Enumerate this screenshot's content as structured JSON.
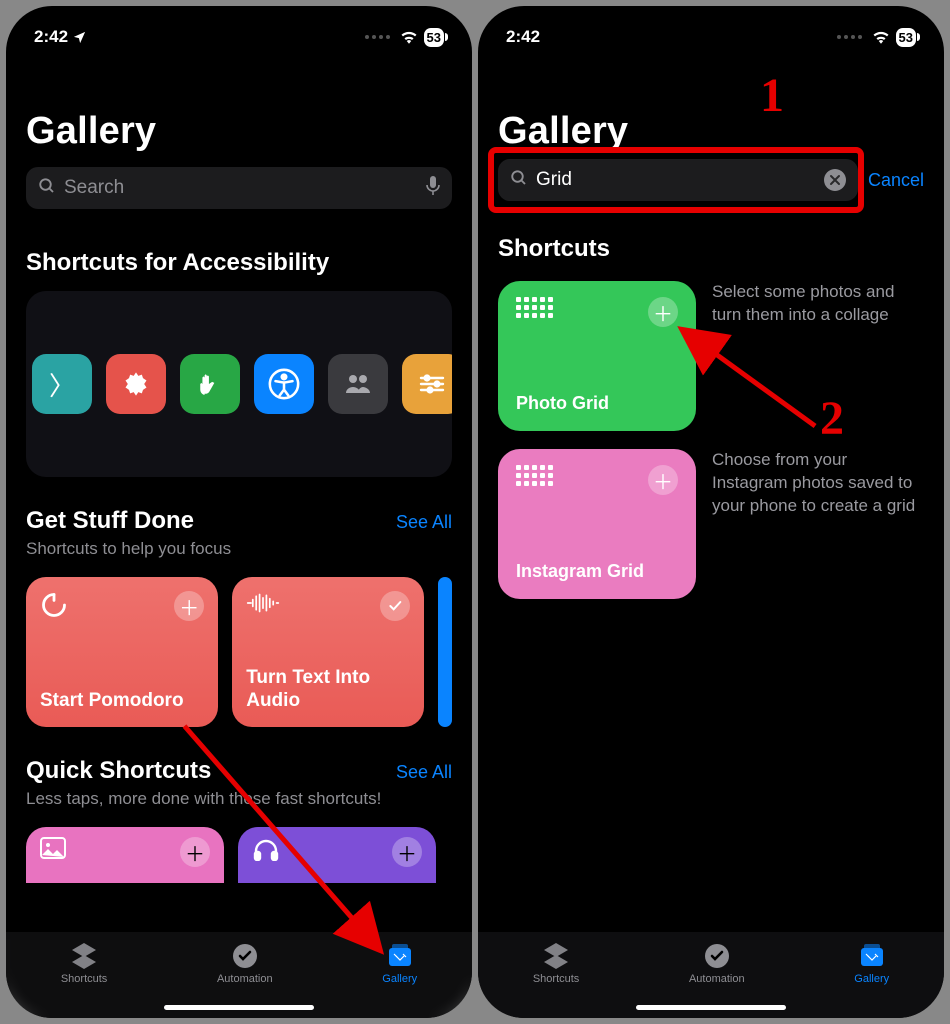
{
  "status": {
    "time": "2:42",
    "battery": "53"
  },
  "left": {
    "title": "Gallery",
    "search_placeholder": "Search",
    "sections": {
      "accessibility_title": "Shortcuts for Accessibility",
      "done_title": "Get Stuff Done",
      "done_sub": "Shortcuts to help you focus",
      "done_see_all": "See All",
      "quick_title": "Quick Shortcuts",
      "quick_sub": "Less taps, more done with these fast shortcuts!",
      "quick_see_all": "See All"
    },
    "done_cards": [
      {
        "label": "Start Pomodoro",
        "color": "#ec6a66"
      },
      {
        "label": "Turn Text Into Audio",
        "color": "#ea5e5a"
      }
    ],
    "tabs": {
      "shortcuts": "Shortcuts",
      "automation": "Automation",
      "gallery": "Gallery"
    }
  },
  "right": {
    "title": "Gallery",
    "search_value": "Grid",
    "cancel": "Cancel",
    "results_title": "Shortcuts",
    "results": [
      {
        "label": "Photo Grid",
        "desc": "Select some photos and turn them into a collage",
        "color": "#34c759"
      },
      {
        "label": "Instagram Grid",
        "desc": "Choose from your Instagram photos saved to your phone to create a grid",
        "color": "#ea7cc0"
      }
    ],
    "tabs": {
      "shortcuts": "Shortcuts",
      "automation": "Automation",
      "gallery": "Gallery"
    }
  },
  "annotations": {
    "one": "1",
    "two": "2"
  }
}
